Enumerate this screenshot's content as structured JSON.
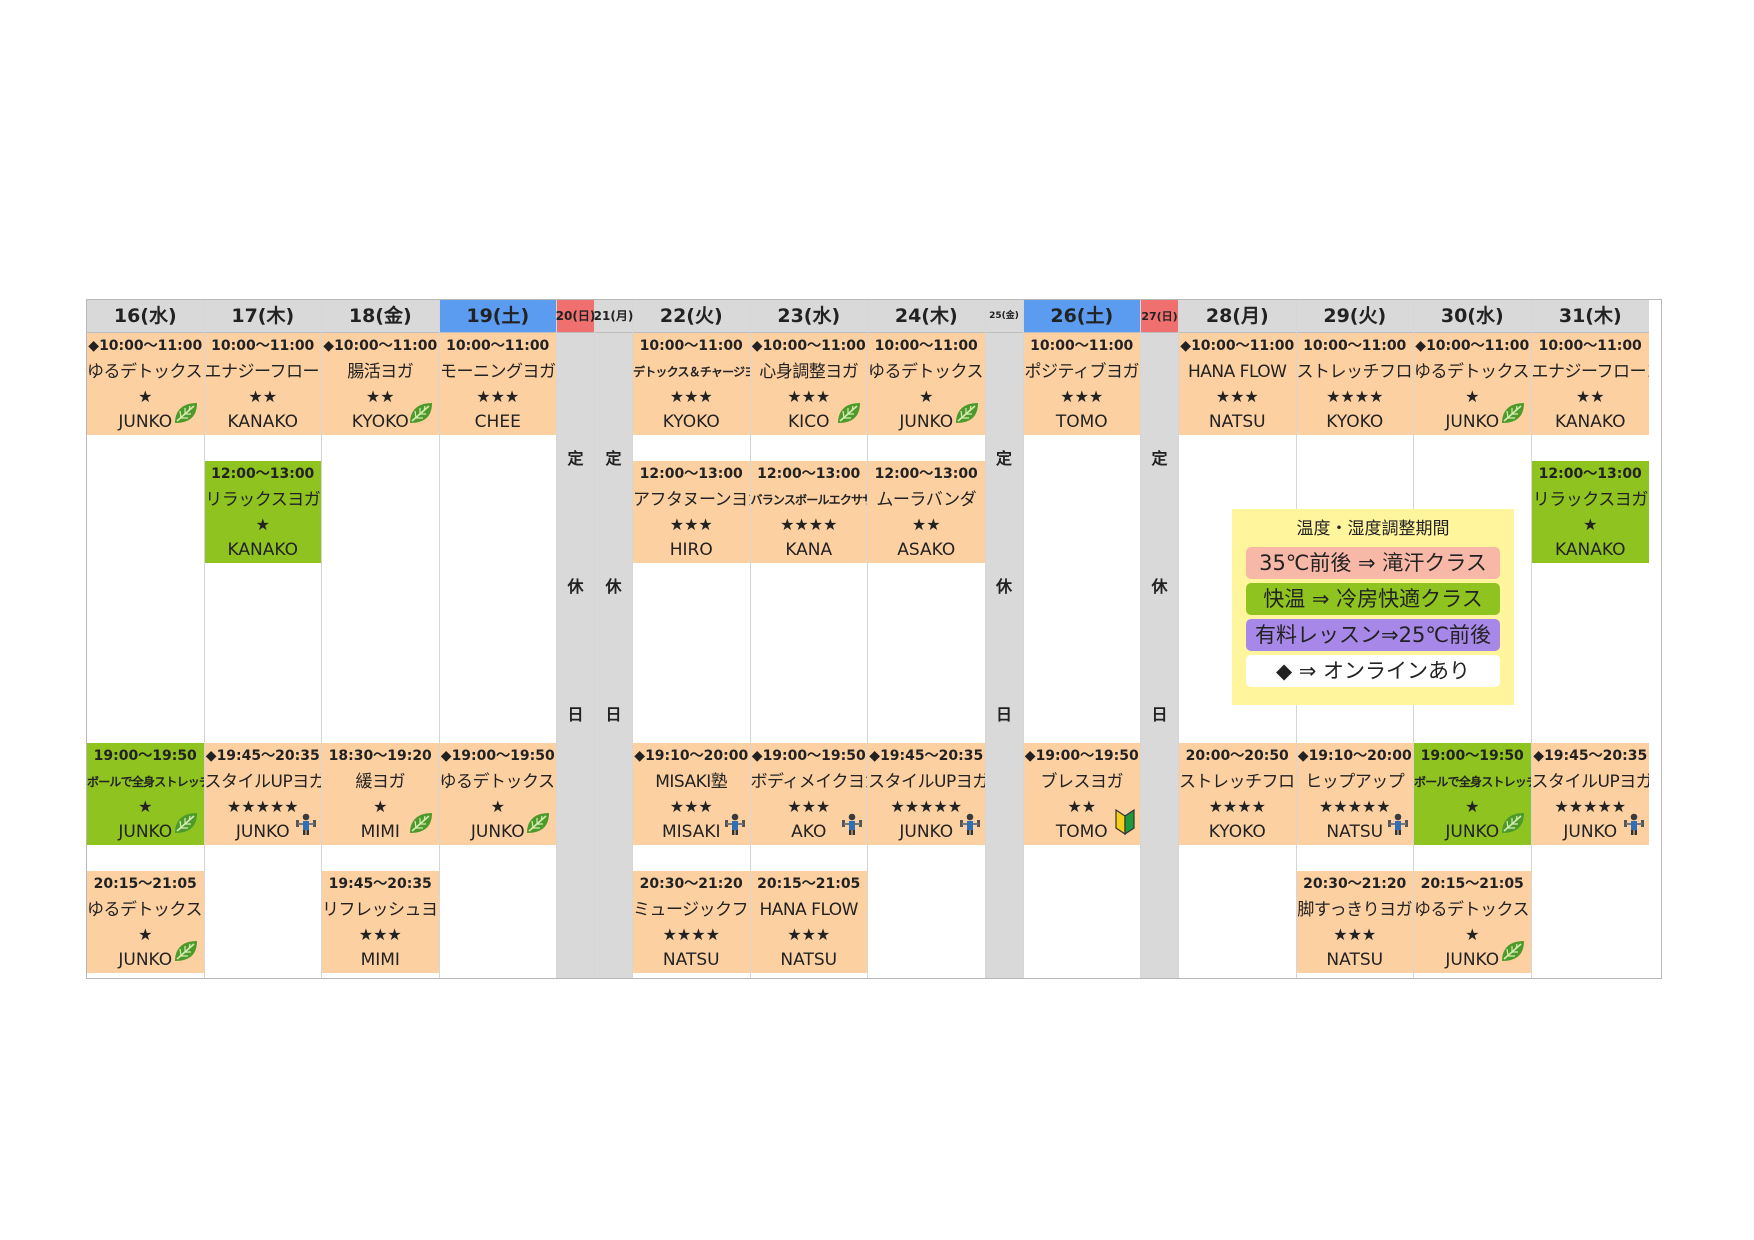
{
  "days": [
    {
      "label": "16(水)",
      "type": "weekday",
      "closed": false
    },
    {
      "label": "17(木)",
      "type": "weekday",
      "closed": false
    },
    {
      "label": "18(金)",
      "type": "weekday",
      "closed": false
    },
    {
      "label": "19(土)",
      "type": "sat",
      "closed": false
    },
    {
      "label": "20(日)",
      "type": "sun",
      "closed": true
    },
    {
      "label": "21(月)",
      "type": "weekday",
      "closed": true
    },
    {
      "label": "22(火)",
      "type": "weekday",
      "closed": false
    },
    {
      "label": "23(水)",
      "type": "weekday",
      "closed": false
    },
    {
      "label": "24(木)",
      "type": "weekday",
      "closed": false
    },
    {
      "label": "25(金)",
      "type": "weekday",
      "closed": true
    },
    {
      "label": "26(土)",
      "type": "sat",
      "closed": false
    },
    {
      "label": "27(日)",
      "type": "sun",
      "closed": true
    },
    {
      "label": "28(月)",
      "type": "weekday",
      "closed": false
    },
    {
      "label": "29(火)",
      "type": "weekday",
      "closed": false
    },
    {
      "label": "30(水)",
      "type": "weekday",
      "closed": false
    },
    {
      "label": "31(木)",
      "type": "weekday",
      "closed": false
    }
  ],
  "closed_text": [
    "定",
    "休",
    "日"
  ],
  "lessons": [
    {
      "day": 0,
      "slot": 0,
      "time": "◆10:00～11:00",
      "name": "ゆるデトックスヨガ",
      "stars": "★",
      "instructor": "JUNKO",
      "color": "orange",
      "icon": "leaf-icon"
    },
    {
      "day": 0,
      "slot": 2,
      "time": "19:00～19:50",
      "name": "ボールで全身ストレッチ",
      "stars": "★",
      "instructor": "JUNKO",
      "color": "green",
      "icon": "leaf-icon",
      "small": true
    },
    {
      "day": 0,
      "slot": 3,
      "time": "20:15～21:05",
      "name": "ゆるデトックスヨガ",
      "stars": "★",
      "instructor": "JUNKO",
      "color": "orange",
      "icon": "leaf-icon"
    },
    {
      "day": 1,
      "slot": 0,
      "time": "10:00～11:00",
      "name": "エナジーフローヨガ",
      "stars": "★★",
      "instructor": "KANAKO",
      "color": "orange"
    },
    {
      "day": 1,
      "slot": 1,
      "time": "12:00～13:00",
      "name": "リラックスヨガ",
      "stars": "★",
      "instructor": "KANAKO",
      "color": "green"
    },
    {
      "day": 1,
      "slot": 2,
      "time": "◆19:45～20:35",
      "name": "スタイルUPヨガ",
      "stars": "★★★★★",
      "instructor": "JUNKO",
      "color": "orange",
      "icon": "dumbbell-icon"
    },
    {
      "day": 2,
      "slot": 0,
      "time": "◆10:00～11:00",
      "name": "腸活ヨガ",
      "stars": "★★",
      "instructor": "KYOKO",
      "color": "orange",
      "icon": "leaf-icon"
    },
    {
      "day": 2,
      "slot": 2,
      "time": "18:30～19:20",
      "name": "緩ヨガ",
      "stars": "★",
      "instructor": "MIMI",
      "color": "orange",
      "icon": "leaf-icon"
    },
    {
      "day": 2,
      "slot": 3,
      "time": "19:45～20:35",
      "name": "リフレッシュヨガ",
      "stars": "★★★",
      "instructor": "MIMI",
      "color": "orange"
    },
    {
      "day": 3,
      "slot": 0,
      "time": "10:00～11:00",
      "name": "モーニングヨガ",
      "stars": "★★★",
      "instructor": "CHEE",
      "color": "orange"
    },
    {
      "day": 3,
      "slot": 2,
      "time": "◆19:00～19:50",
      "name": "ゆるデトックスヨガ",
      "stars": "★",
      "instructor": "JUNKO",
      "color": "orange",
      "icon": "leaf-icon"
    },
    {
      "day": 6,
      "slot": 0,
      "time": "10:00～11:00",
      "name": "デトックス＆チャージヨガ",
      "stars": "★★★",
      "instructor": "KYOKO",
      "color": "orange",
      "small": true
    },
    {
      "day": 6,
      "slot": 1,
      "time": "12:00～13:00",
      "name": "アフタヌーンヨガ",
      "stars": "★★★",
      "instructor": "HIRO",
      "color": "orange"
    },
    {
      "day": 6,
      "slot": 2,
      "time": "◆19:10～20:00",
      "name": "MISAKI塾",
      "stars": "★★★",
      "instructor": "MISAKI",
      "color": "orange",
      "icon": "dumbbell-icon"
    },
    {
      "day": 6,
      "slot": 3,
      "time": "20:30～21:20",
      "name": "ミュージックフロー",
      "stars": "★★★★",
      "instructor": "NATSU",
      "color": "orange"
    },
    {
      "day": 7,
      "slot": 0,
      "time": "◆10:00～11:00",
      "name": "心身調整ヨガ",
      "stars": "★★★",
      "instructor": "KICO",
      "color": "orange",
      "icon": "leaf-icon"
    },
    {
      "day": 7,
      "slot": 1,
      "time": "12:00～13:00",
      "name": "バランスボールエクササイズ",
      "stars": "★★★★",
      "instructor": "KANA",
      "color": "orange",
      "small": true
    },
    {
      "day": 7,
      "slot": 2,
      "time": "◆19:00～19:50",
      "name": "ボディメイクヨガ",
      "stars": "★★★",
      "instructor": "AKO",
      "color": "orange",
      "icon": "dumbbell-icon"
    },
    {
      "day": 7,
      "slot": 3,
      "time": "20:15～21:05",
      "name": "HANA FLOW",
      "stars": "★★★",
      "instructor": "NATSU",
      "color": "orange"
    },
    {
      "day": 8,
      "slot": 0,
      "time": "10:00～11:00",
      "name": "ゆるデトックスヨガ",
      "stars": "★",
      "instructor": "JUNKO",
      "color": "orange",
      "icon": "leaf-icon"
    },
    {
      "day": 8,
      "slot": 1,
      "time": "12:00～13:00",
      "name": "ムーラバンダ",
      "stars": "★★",
      "instructor": "ASAKO",
      "color": "orange"
    },
    {
      "day": 8,
      "slot": 2,
      "time": "◆19:45～20:35",
      "name": "スタイルUPヨガ",
      "stars": "★★★★★",
      "instructor": "JUNKO",
      "color": "orange",
      "icon": "dumbbell-icon"
    },
    {
      "day": 10,
      "slot": 0,
      "time": "10:00～11:00",
      "name": "ポジティブヨガ",
      "stars": "★★★",
      "instructor": "TOMO",
      "color": "orange"
    },
    {
      "day": 10,
      "slot": 2,
      "time": "◆19:00～19:50",
      "name": "ブレスヨガ",
      "stars": "★★",
      "instructor": "TOMO",
      "color": "orange",
      "icon": "beginner-mark-icon"
    },
    {
      "day": 12,
      "slot": 0,
      "time": "◆10:00～11:00",
      "name": "HANA FLOW",
      "stars": "★★★",
      "instructor": "NATSU",
      "color": "orange"
    },
    {
      "day": 12,
      "slot": 2,
      "time": "20:00～20:50",
      "name": "ストレッチフローヨガ",
      "stars": "★★★★",
      "instructor": "KYOKO",
      "color": "orange"
    },
    {
      "day": 13,
      "slot": 0,
      "time": "10:00～11:00",
      "name": "ストレッチフローヨガ",
      "stars": "★★★★",
      "instructor": "KYOKO",
      "color": "orange"
    },
    {
      "day": 13,
      "slot": 2,
      "time": "◆19:10～20:00",
      "name": "ヒップアップ",
      "stars": "★★★★★",
      "instructor": "NATSU",
      "color": "orange",
      "icon": "dumbbell-icon"
    },
    {
      "day": 13,
      "slot": 3,
      "time": "20:30～21:20",
      "name": "脚すっきりヨガ",
      "stars": "★★★",
      "instructor": "NATSU",
      "color": "orange"
    },
    {
      "day": 14,
      "slot": 0,
      "time": "◆10:00～11:00",
      "name": "ゆるデトックスヨガ",
      "stars": "★",
      "instructor": "JUNKO",
      "color": "orange",
      "icon": "leaf-icon"
    },
    {
      "day": 14,
      "slot": 2,
      "time": "19:00～19:50",
      "name": "ボールで全身ストレッチ",
      "stars": "★",
      "instructor": "JUNKO",
      "color": "green",
      "icon": "leaf-icon",
      "small": true
    },
    {
      "day": 14,
      "slot": 3,
      "time": "20:15～21:05",
      "name": "ゆるデトックスヨガ",
      "stars": "★",
      "instructor": "JUNKO",
      "color": "orange",
      "icon": "leaf-icon"
    },
    {
      "day": 15,
      "slot": 0,
      "time": "10:00～11:00",
      "name": "エナジーフローヨガ",
      "stars": "★★",
      "instructor": "KANAKO",
      "color": "orange"
    },
    {
      "day": 15,
      "slot": 1,
      "time": "12:00～13:00",
      "name": "リラックスヨガ",
      "stars": "★",
      "instructor": "KANAKO",
      "color": "green"
    },
    {
      "day": 15,
      "slot": 2,
      "time": "◆19:45～20:35",
      "name": "スタイルUPヨガ",
      "stars": "★★★★★",
      "instructor": "JUNKO",
      "color": "orange",
      "icon": "dumbbell-icon"
    }
  ],
  "legend": {
    "title": "温度・湿度調整期間",
    "items": [
      {
        "text": "35℃前後 ⇒ 滝汗クラス",
        "color": "#f8b8a8"
      },
      {
        "text": "快温 ⇒ 冷房快適クラス",
        "color": "#8fc31f"
      },
      {
        "text": "有料レッスン⇒25℃前後",
        "color": "#a787e8"
      },
      {
        "text": "◆ ⇒ オンラインあり",
        "color": "#ffffff"
      }
    ]
  },
  "colors": {
    "orange": "#fdd0a2",
    "green": "#8fc31f",
    "sat": "#5b9bf0",
    "sun": "#f07070",
    "closed": "#d9d9d9"
  }
}
